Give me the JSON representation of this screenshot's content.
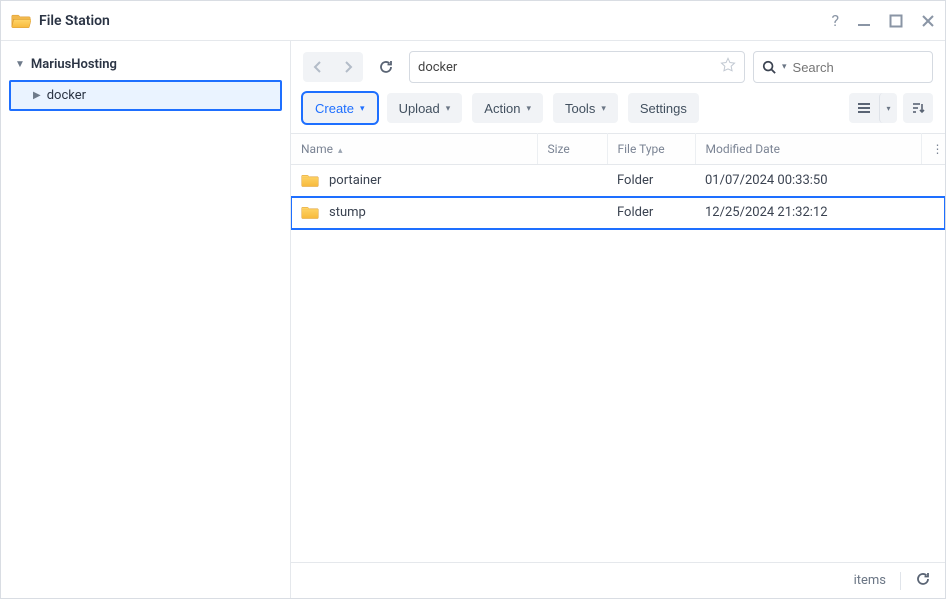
{
  "app": {
    "title": "File Station"
  },
  "sidebar": {
    "root": "MariusHosting",
    "items": [
      {
        "label": "docker"
      }
    ]
  },
  "path": {
    "current": "docker"
  },
  "search": {
    "placeholder": "Search"
  },
  "toolbar": {
    "create": "Create",
    "upload": "Upload",
    "action": "Action",
    "tools": "Tools",
    "settings": "Settings"
  },
  "columns": {
    "name": "Name",
    "size": "Size",
    "file_type": "File Type",
    "modified": "Modified Date"
  },
  "rows": [
    {
      "name": "portainer",
      "size": "",
      "file_type": "Folder",
      "modified": "01/07/2024 00:33:50",
      "highlight": false
    },
    {
      "name": "stump",
      "size": "",
      "file_type": "Folder",
      "modified": "12/25/2024 21:32:12",
      "highlight": true
    }
  ],
  "status": {
    "items_label": "items"
  }
}
